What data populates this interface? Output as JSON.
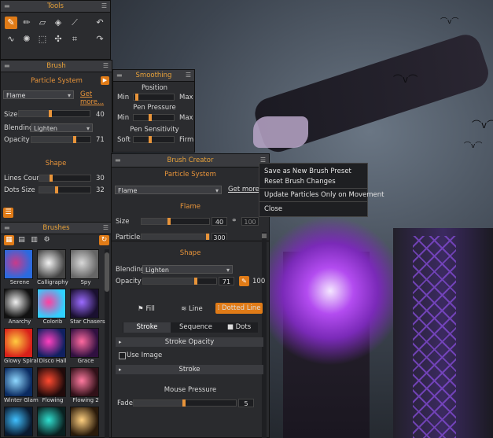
{
  "tools": {
    "title": "Tools",
    "icons": [
      "brush-icon",
      "pencil-icon",
      "eraser-icon",
      "fill-icon",
      "eyedropper-icon",
      "undo-icon",
      "smudge-icon",
      "particle-icon",
      "select-rect-icon",
      "transform-icon",
      "crop-icon",
      "redo-icon"
    ]
  },
  "brush": {
    "title": "Brush",
    "particle_label": "Particle System",
    "preset": "Flame",
    "get_more": "Get more...",
    "size_label": "Size",
    "size_value": "40",
    "blending_label": "Blending",
    "blending_value": "Lighten",
    "opacity_label": "Opacity",
    "opacity_value": "71",
    "shape_section": "Shape",
    "lines_label": "Lines Count",
    "lines_value": "30",
    "dots_label": "Dots Size",
    "dots_value": "32"
  },
  "smoothing": {
    "title": "Smoothing",
    "position": "Position",
    "pressure": "Pen Pressure",
    "sensitivity": "Pen Sensitivity",
    "min": "Min",
    "max": "Max",
    "soft": "Soft",
    "firm": "Firm"
  },
  "brushes": {
    "title": "Brushes",
    "items": [
      {
        "name": "Serene",
        "c1": "#c83a8a",
        "c2": "#2a6be0"
      },
      {
        "name": "Calligraphy",
        "c1": "#f2f2f2",
        "c2": "#444444"
      },
      {
        "name": "Spy",
        "c1": "#d8d8d8",
        "c2": "#666666"
      },
      {
        "name": "Anarchy",
        "c1": "#f0f0f0",
        "c2": "#111111"
      },
      {
        "name": "Colorib",
        "c1": "#ff3fa0",
        "c2": "#30d0ff"
      },
      {
        "name": "Star Chasers",
        "c1": "#9b6bff",
        "c2": "#1a1030"
      },
      {
        "name": "Glowy Spiral",
        "c1": "#ffcc40",
        "c2": "#d8201a"
      },
      {
        "name": "Disco Hall",
        "c1": "#ff40c0",
        "c2": "#102060"
      },
      {
        "name": "Grace",
        "c1": "#ff6aa0",
        "c2": "#301040"
      },
      {
        "name": "Winter Glam",
        "c1": "#8fd8ff",
        "c2": "#0a2a60"
      },
      {
        "name": "Flowing",
        "c1": "#ff4a30",
        "c2": "#200a0a"
      },
      {
        "name": "Flowing 2",
        "c1": "#ff7aa0",
        "c2": "#301018"
      },
      {
        "name": "",
        "c1": "#40c0ff",
        "c2": "#0a1a30"
      },
      {
        "name": "",
        "c1": "#30e0d0",
        "c2": "#0a2020"
      },
      {
        "name": "",
        "c1": "#ffd080",
        "c2": "#2a1a0a"
      }
    ]
  },
  "creator": {
    "title": "Brush Creator",
    "particle_label": "Particle System",
    "preset": "Flame",
    "get_more": "Get more...",
    "flame_section": "Flame",
    "size_label": "Size",
    "size_value": "40",
    "size_max": "100",
    "particles_label": "Particles",
    "particles_value": "300",
    "shape_section": "Shape",
    "blending_label": "Blending",
    "blending_value": "Lighten",
    "opacity_label": "Opacity",
    "opacity_value": "71",
    "opacity_max": "100",
    "fill_tab": "Fill",
    "line_tab": "Line",
    "dotted_tab": "Dotted Line",
    "stroke_tab": "Stroke",
    "sequence_tab": "Sequence",
    "dots_tab": "Dots",
    "stroke_opacity": "Stroke Opacity",
    "use_image": "Use Image",
    "stroke": "Stroke",
    "mouse_pressure": "Mouse Pressure",
    "fade_label": "Fade",
    "fade_value": "5"
  },
  "context_menu": {
    "save": "Save as New Brush Preset",
    "reset": "Reset Brush Changes",
    "update": "Update Particles Only on Movement",
    "close": "Close"
  },
  "colors": {
    "accent": "#e07b17",
    "panel": "#2b2c2f",
    "header": "#3a3b3f"
  }
}
